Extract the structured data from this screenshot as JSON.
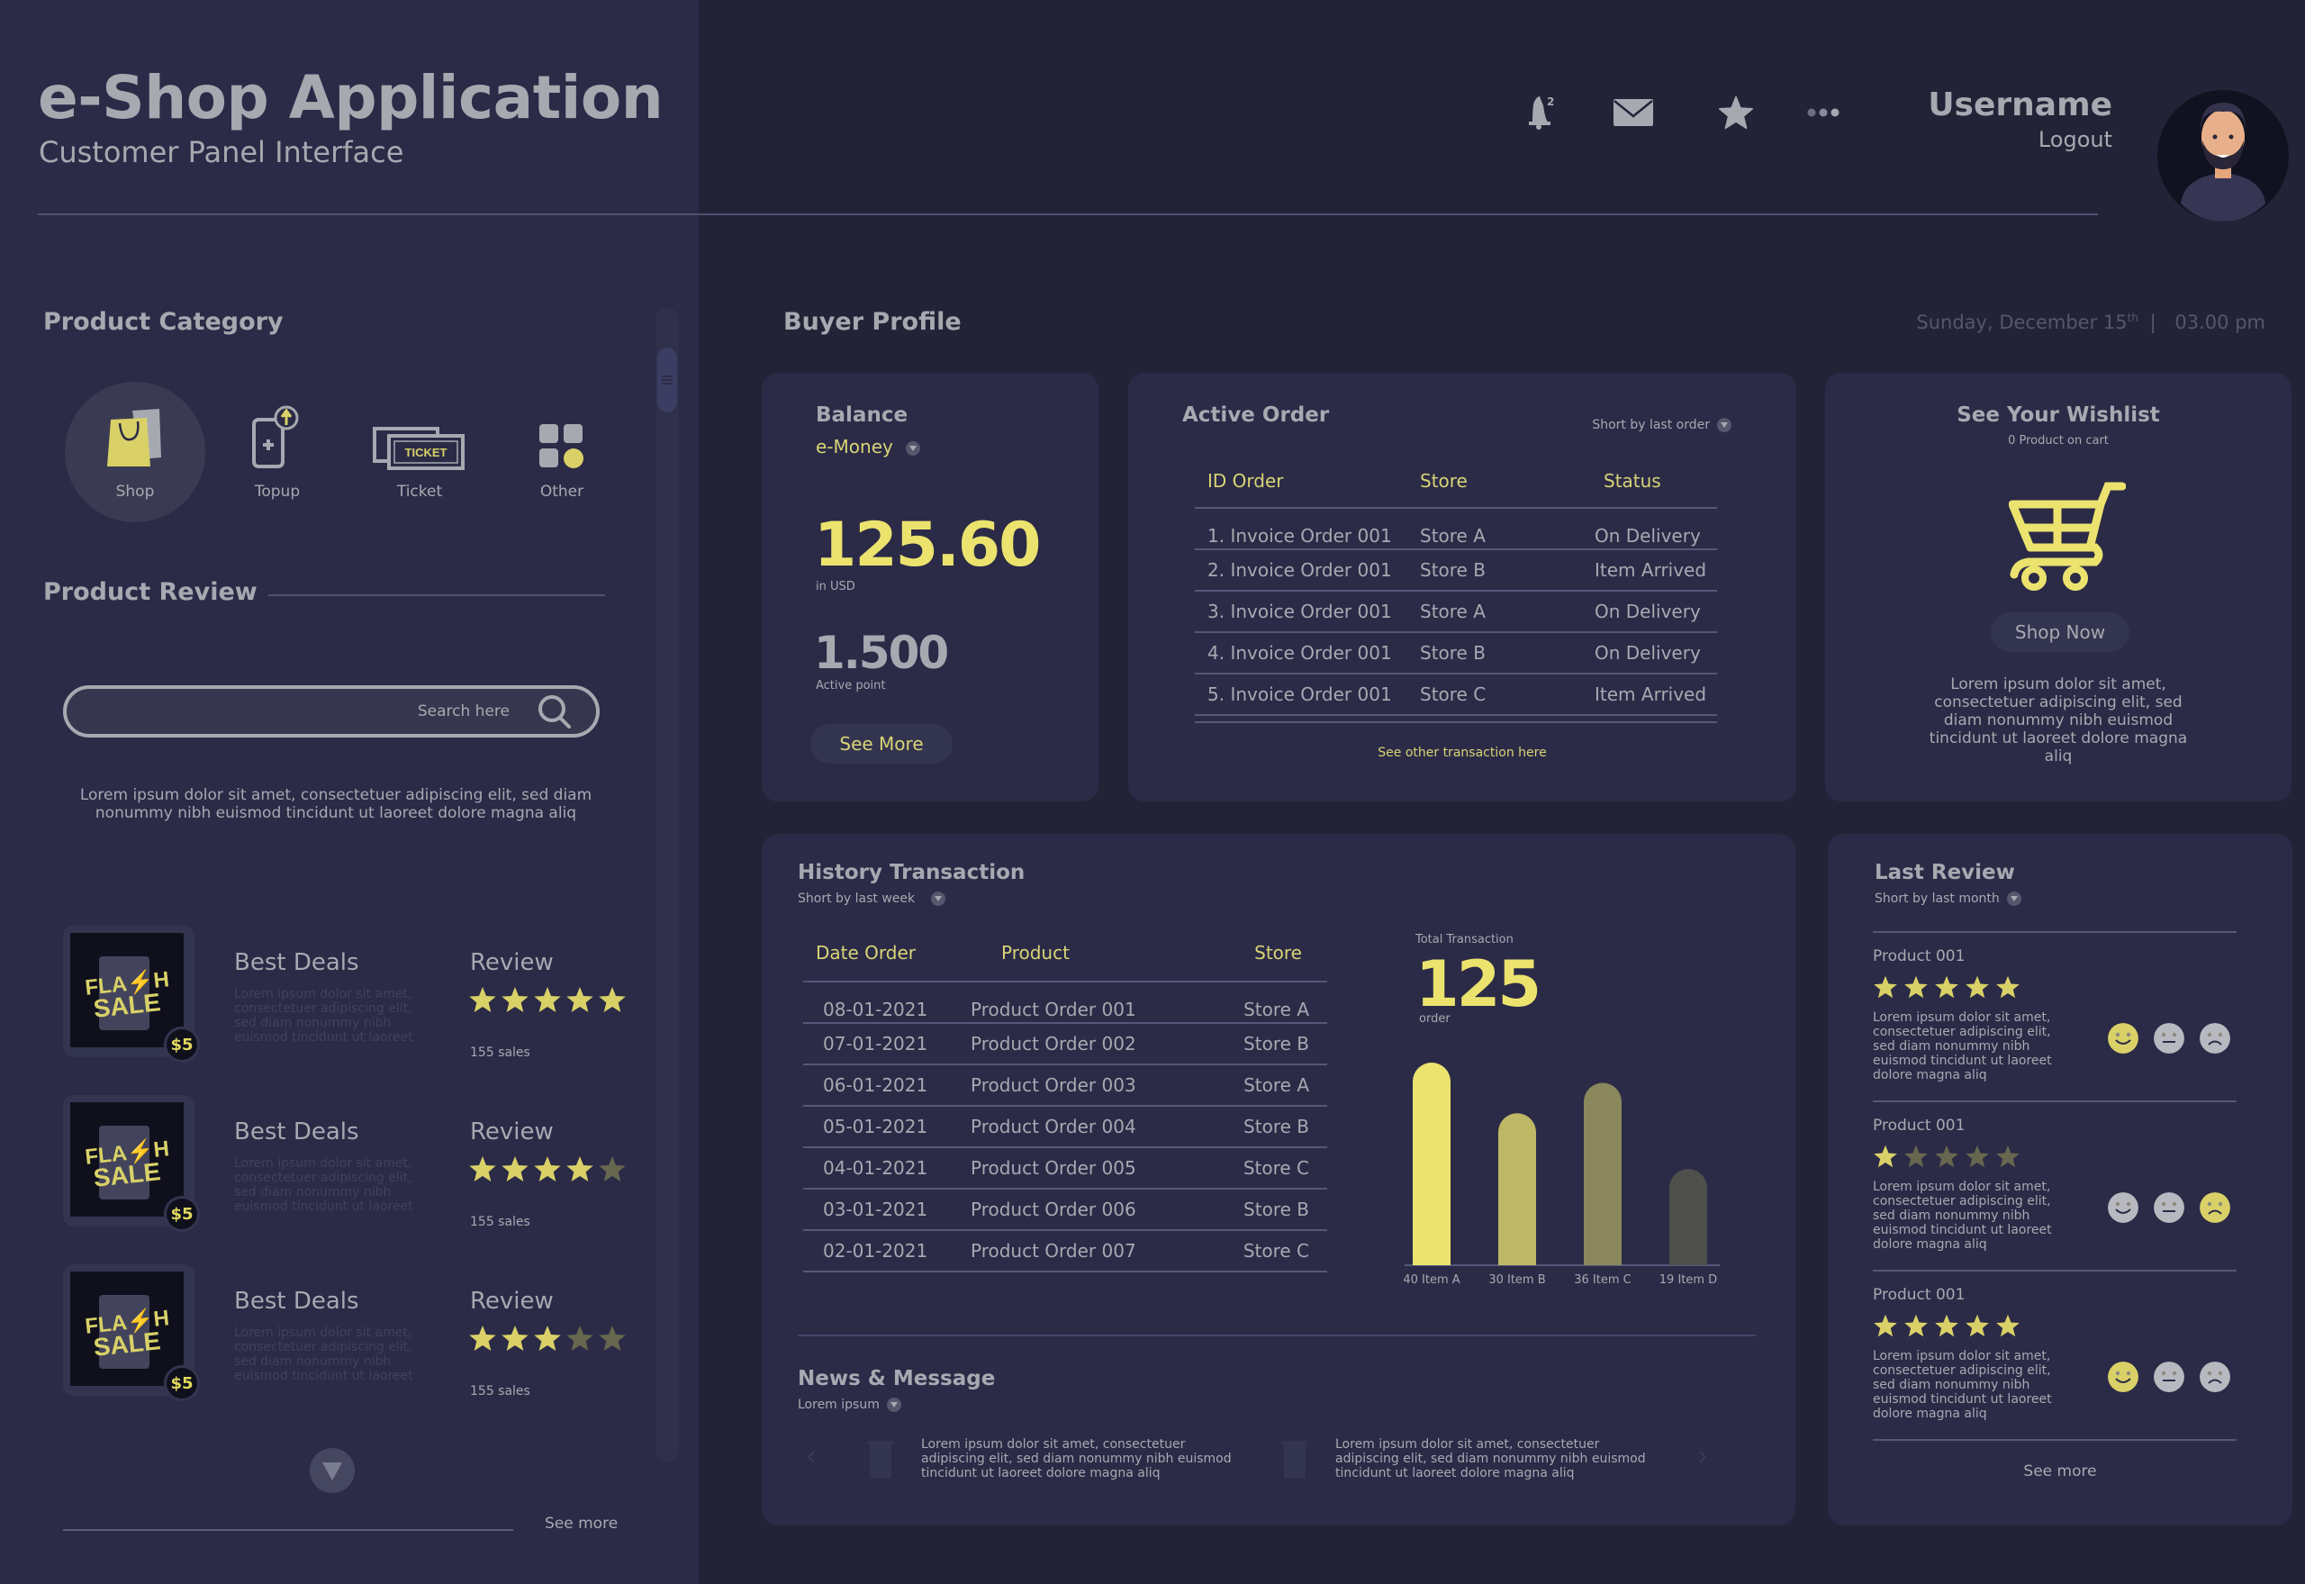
{
  "header": {
    "title": "e-Shop Application",
    "subtitle": "Customer Panel Interface",
    "notification_count": "2",
    "username": "Username",
    "logout": "Logout",
    "icons": [
      "bell-icon",
      "mail-icon",
      "star-icon",
      "more-icon"
    ]
  },
  "sidebar": {
    "category_title": "Product Category",
    "categories": [
      {
        "label": "Shop",
        "icon": "shopping-bag-icon",
        "active": true
      },
      {
        "label": "Topup",
        "icon": "topup-phone-icon",
        "active": false
      },
      {
        "label": "Ticket",
        "icon": "ticket-icon",
        "active": false
      },
      {
        "label": "Other",
        "icon": "grid-icon",
        "active": false
      }
    ],
    "review_title": "Product Review",
    "search_placeholder": "Search here",
    "lorem": "Lorem ipsum dolor sit amet, consectetuer adipiscing elit, sed diam nonummy nibh euismod tincidunt ut laoreet dolore magna aliq",
    "deals": [
      {
        "name": "Best Deals",
        "price": "$5",
        "desc": "Lorem ipsum dolor sit amet, consectetuer adipiscing elit, sed diam nonummy nibh euismod tincidunt ut laoreet",
        "review_label": "Review",
        "rating": 5,
        "sales": "155 sales",
        "badge": "FLASH SALE"
      },
      {
        "name": "Best Deals",
        "price": "$5",
        "desc": "Lorem ipsum dolor sit amet, consectetuer adipiscing elit, sed diam nonummy nibh euismod tincidunt ut laoreet",
        "review_label": "Review",
        "rating": 4,
        "sales": "155 sales",
        "badge": "FLASH SALE"
      },
      {
        "name": "Best Deals",
        "price": "$5",
        "desc": "Lorem ipsum dolor sit amet, consectetuer adipiscing elit, sed diam nonummy nibh euismod tincidunt ut laoreet",
        "review_label": "Review",
        "rating": 3,
        "sales": "155 sales",
        "badge": "FLASH SALE"
      }
    ],
    "see_more": "See more"
  },
  "buyer_profile": {
    "title": "Buyer Profile",
    "date": "Sunday, December 15",
    "date_suffix": "th",
    "separator": "|",
    "time": "03.00 pm"
  },
  "balance": {
    "title": "Balance",
    "currency_select": "e-Money",
    "amount": "125.60",
    "amount_unit": "in USD",
    "points": "1.500",
    "points_label": "Active point",
    "button": "See More"
  },
  "active_order": {
    "title": "Active Order",
    "sort": "Short by last order",
    "columns": [
      "ID Order",
      "Store",
      "Status"
    ],
    "rows": [
      [
        "1. Invoice Order 001",
        "Store A",
        "On Delivery"
      ],
      [
        "2. Invoice Order 001",
        "Store B",
        "Item Arrived"
      ],
      [
        "3. Invoice Order 001",
        "Store A",
        "On Delivery"
      ],
      [
        "4. Invoice Order 001",
        "Store B",
        "On Delivery"
      ],
      [
        "5. Invoice Order 001",
        "Store C",
        "Item Arrived"
      ]
    ],
    "link": "See other transaction here"
  },
  "wishlist": {
    "title": "See Your Wishlist",
    "count": "0 Product on cart",
    "button": "Shop Now",
    "lorem": "Lorem ipsum dolor sit amet, consectetuer adipiscing elit, sed diam nonummy nibh euismod tincidunt ut laoreet dolore magna aliq"
  },
  "history": {
    "title": "History Transaction",
    "sort": "Short by last week",
    "columns": [
      "Date Order",
      "Product",
      "Store"
    ],
    "rows": [
      [
        "08-01-2021",
        "Product Order 001",
        "Store A"
      ],
      [
        "07-01-2021",
        "Product Order 002",
        "Store B"
      ],
      [
        "06-01-2021",
        "Product Order 003",
        "Store A"
      ],
      [
        "05-01-2021",
        "Product Order 004",
        "Store B"
      ],
      [
        "04-01-2021",
        "Product Order 005",
        "Store C"
      ],
      [
        "03-01-2021",
        "Product Order 006",
        "Store B"
      ],
      [
        "02-01-2021",
        "Product Order 007",
        "Store C"
      ]
    ],
    "total_label": "Total Transaction",
    "total_value": "125",
    "total_unit": "order"
  },
  "chart_data": {
    "type": "bar",
    "title": "Total Transaction",
    "categories": [
      "Item A",
      "Item B",
      "Item C",
      "Item D"
    ],
    "values": [
      40,
      30,
      36,
      19
    ],
    "tick_labels": [
      "40 Item A",
      "30 Item B",
      "36 Item C",
      "19 Item D"
    ],
    "colors": [
      "#ece36f",
      "#bdb766",
      "#8a875c",
      "#4f4f4c"
    ],
    "xlabel": "",
    "ylabel": "",
    "grid": false
  },
  "news": {
    "title": "News & Message",
    "sort": "Lorem ipsum",
    "items": [
      {
        "text": "Lorem ipsum dolor sit amet, consectetuer adipiscing elit, sed diam nonummy nibh euismod tincidunt ut laoreet dolore magna aliq"
      },
      {
        "text": "Lorem ipsum dolor sit amet, consectetuer adipiscing elit, sed diam nonummy nibh euismod tincidunt ut laoreet dolore magna aliq"
      }
    ]
  },
  "last_review": {
    "title": "Last Review",
    "sort": "Short by last month",
    "items": [
      {
        "product": "Product 001",
        "rating": 5,
        "text": "Lorem ipsum dolor sit amet, consectetuer adipiscing elit, sed diam nonummy nibh euismod tincidunt ut laoreet dolore magna aliq",
        "mood": "happy"
      },
      {
        "product": "Product 001",
        "rating": 1,
        "text": "Lorem ipsum dolor sit amet, consectetuer adipiscing elit, sed diam nonummy nibh euismod tincidunt ut laoreet dolore magna aliq",
        "mood": "sad"
      },
      {
        "product": "Product 001",
        "rating": 5,
        "text": "Lorem ipsum dolor sit amet, consectetuer adipiscing elit, sed diam nonummy nibh euismod tincidunt ut laoreet dolore magna aliq",
        "mood": "happy"
      }
    ],
    "see_more": "See more"
  },
  "colors": {
    "accent": "#e2d95e",
    "sidebar_bg": "#2b2b47",
    "main_bg": "#222336",
    "card_bg": "#2b2b47",
    "text": "#a7a9b1",
    "star_off": "#67674f"
  }
}
